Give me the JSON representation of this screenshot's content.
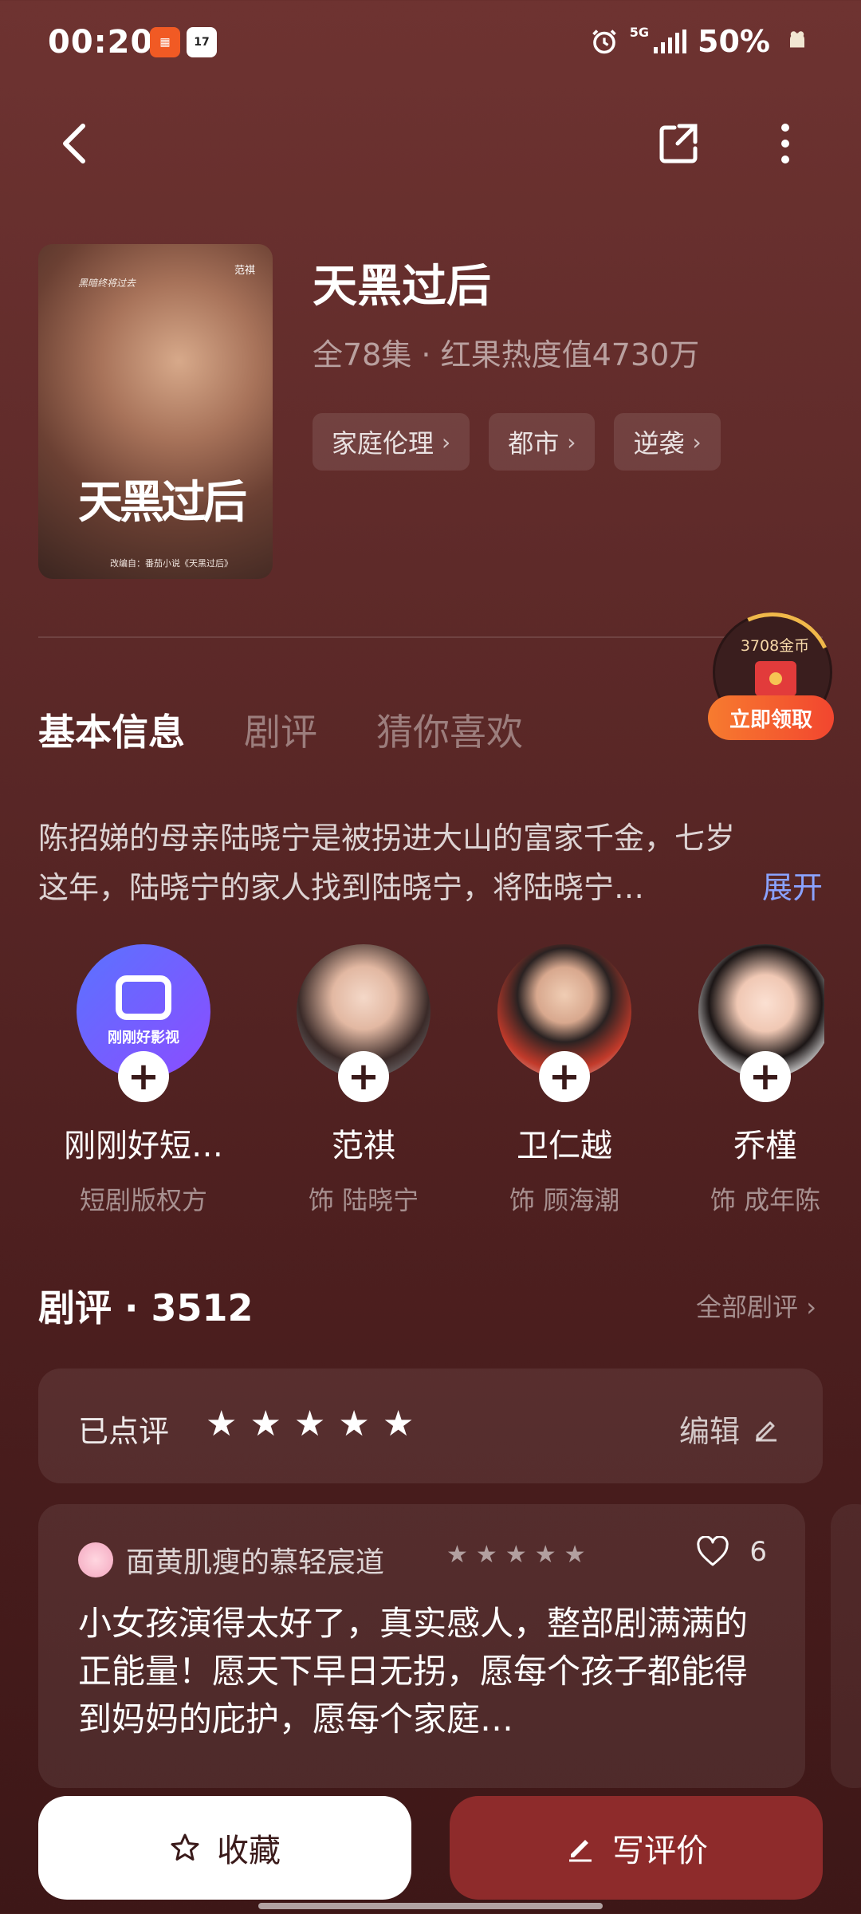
{
  "status_bar": {
    "time": "00:20",
    "network": "5G",
    "battery": "50%",
    "app_icon_1": "app",
    "app_icon_2": "17"
  },
  "nav": {
    "back_icon": "back-chevron-icon",
    "share_icon": "share-icon",
    "more_icon": "more-vertical-icon"
  },
  "drama": {
    "title": "天黑过后",
    "meta": "全78集 · 红果热度值4730万",
    "poster_title": "天黑过后",
    "poster_credit": "改编自：番茄小说《天黑过后》",
    "poster_star": "范祺",
    "poster_quote": "黑暗终将过去",
    "tags": [
      {
        "label": "家庭伦理"
      },
      {
        "label": "都市"
      },
      {
        "label": "逆袭"
      }
    ]
  },
  "coin_widget": {
    "amount": "3708金币",
    "button": "立即领取"
  },
  "tabs": [
    {
      "label": "基本信息",
      "active": true
    },
    {
      "label": "剧评",
      "active": false
    },
    {
      "label": "猜你喜欢",
      "active": false
    }
  ],
  "synopsis": {
    "line1": "陈招娣的母亲陆晓宁是被拐进大山的富家千金，七岁",
    "line2": "这年，陆晓宁的家人找到陆晓宁，将陆晓宁…",
    "expand": "展开"
  },
  "cast": [
    {
      "name": "刚刚好短…",
      "role": "短剧版权方",
      "logo_text": "刚刚好影视"
    },
    {
      "name": "范祺",
      "role": "饰 陆晓宁"
    },
    {
      "name": "卫仁越",
      "role": "饰 顾海潮"
    },
    {
      "name": "乔槿",
      "role": "饰 成年陈"
    }
  ],
  "reviews": {
    "title": "剧评 · 3512",
    "all_link": "全部剧评 ›",
    "rated_label": "已点评",
    "my_rating": 5,
    "edit_label": "编辑",
    "items": [
      {
        "user": "面黄肌瘦的慕轻宸道",
        "rating": 5,
        "likes": "6",
        "text": "小女孩演得太好了，真实感人，整部剧满满的正能量！愿天下早日无拐，愿每个孩子都能得到妈妈的庇护，愿每个家庭…"
      }
    ]
  },
  "bottom_bar": {
    "favorite_label": "收藏",
    "write_label": "写评价"
  },
  "colors": {
    "background": "#5e2a29",
    "accent": "#8e2b2b",
    "link": "#8aa2ff",
    "coin_button": "#f2462f"
  }
}
